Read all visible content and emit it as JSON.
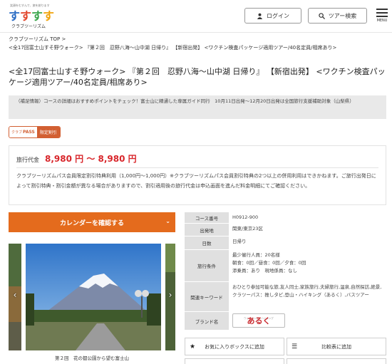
{
  "header": {
    "logo_tagline": "笑顔をむすんで、旅を創ります",
    "logo_text": "クラブツーリズム",
    "login_label": "ログイン",
    "search_label": "ツアー検索",
    "menu_label": "MENU"
  },
  "breadcrumb": {
    "home": "クラブツーリズム TOP",
    "separator": ">",
    "current": "<全17回富士山すそ野ウォーク> 『第２回　忍野八海～山中湖 日帰り』 【新宿出発】 <ワクチン検査パッケージ適用ツアー/40名定員/相席あり>"
  },
  "title": "<全17回富士山すそ野ウォーク> 『第２回　忍野八海～山中湖 日帰り』 【新宿出発】 <ワクチン検査パッケージ適用ツアー/40名定員/相席あり>",
  "info_box": {
    "text": "（補足情報）コースの詳細はおすすめポイントをチェック！富士山に精通した専属ガイド同行　10月11日出発～12月20日出発は全国旅行支援補助対象（山梨県）"
  },
  "pass_badge": {
    "club": "クラブ",
    "pass": "PASS",
    "label": "限定割引"
  },
  "price": {
    "label": "旅行代金",
    "value": "8,980 円 ～ 8,980 円",
    "note": "クラブツーリズムパス会員限定割引特典利用（1,000円～1,000円）※クラブツーリズムパス会員割引特典の2つ以上の併用利用はできかねます。ご旅行出発日によって割引特典・割引金額が異なる場合がありますので、割引適用後の旅行代金は申込画面を進んだ料金明細にてご確認ください。"
  },
  "calendar_button": "カレンダーを確認する",
  "photo_caption": "第２回　花の都公園から望む富士山",
  "details": [
    {
      "label": "コース番号",
      "value": "H0912-900"
    },
    {
      "label": "出発地",
      "value": "関東/東京23区"
    },
    {
      "label": "日数",
      "value": "日帰り"
    },
    {
      "label": "旅行条件",
      "value": "最少催行人員：20名様\n朝食：0回／昼食：0回／夕食：0回\n添乗員：あり　現地係員：なし"
    },
    {
      "label": "関連キーワード",
      "value": "おひとり参加可能な旅,友人同士,家族旅行,夫婦旅行,温泉,自然探訪,絶景,クラツーパス：推しタビ,登山・ハイキング（あるく）,バスツアー"
    },
    {
      "label": "ブランド名",
      "value": ""
    }
  ],
  "brand": {
    "small": "ウォーキング・ハイキング",
    "name": "あるく"
  },
  "actions": {
    "favorite": "お気に入りボックスに追加",
    "compare": "比較表に追加"
  },
  "colors": {
    "accent_orange": "#e46b1d",
    "price_red": "#d8262b",
    "pass_orange": "#d25f32"
  }
}
